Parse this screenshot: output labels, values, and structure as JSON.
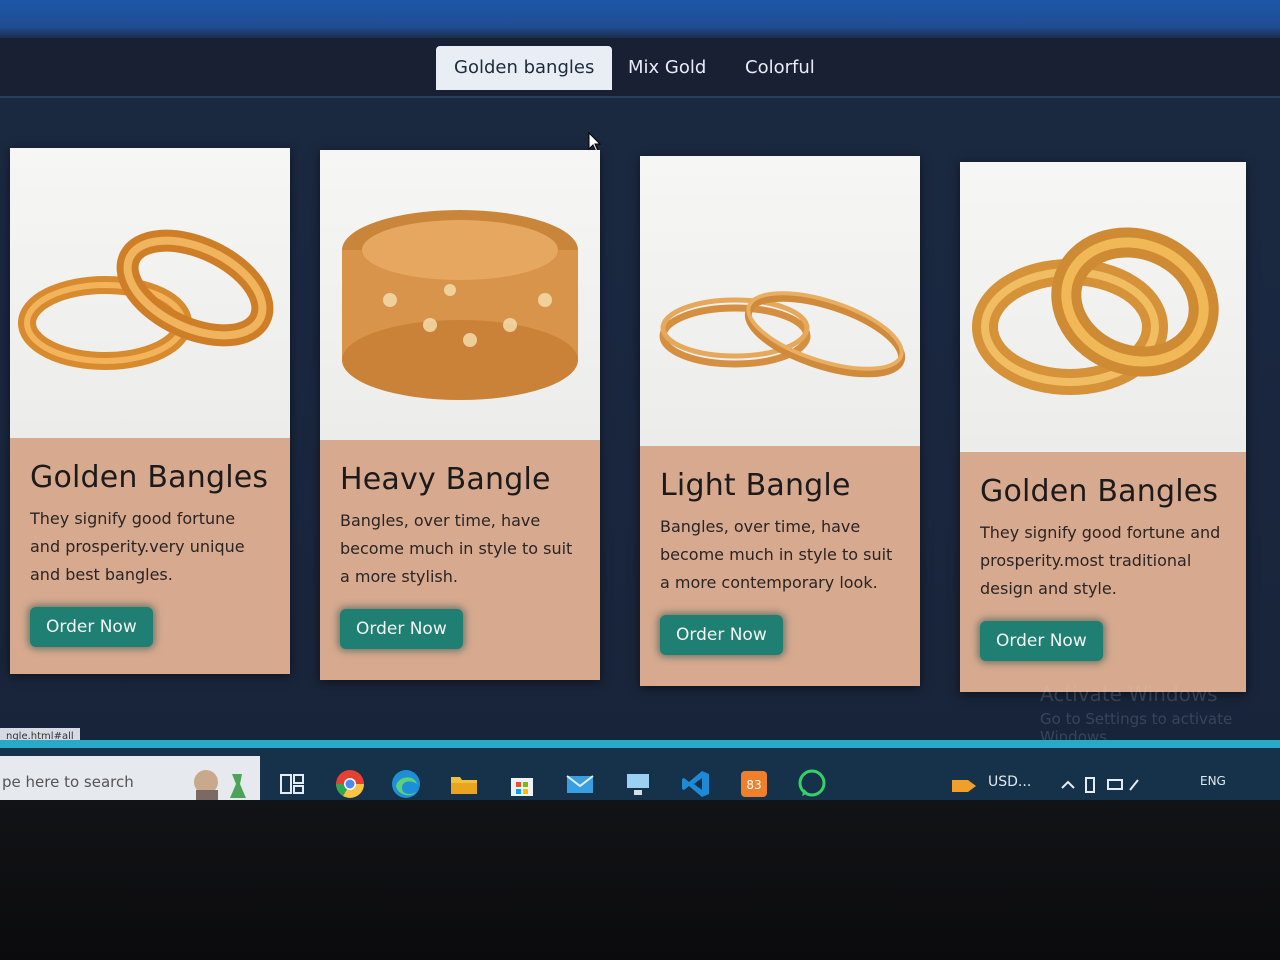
{
  "nav": {
    "tabs": [
      {
        "label": "Golden bangles",
        "active": true
      },
      {
        "label": "Mix Gold",
        "active": false
      },
      {
        "label": "Colorful",
        "active": false
      }
    ]
  },
  "cards": [
    {
      "title": "Golden Bangles",
      "description": "They signify good fortune and prosperity.very unique and best bangles.",
      "button": "Order Now",
      "image_icon": "two-gold-bangles"
    },
    {
      "title": "Heavy Bangle",
      "description": "Bangles, over time, have become much in style to suit a more stylish.",
      "button": "Order Now",
      "image_icon": "wide-gold-bangle"
    },
    {
      "title": "Light Bangle",
      "description": "Bangles, over time, have become much in style to suit a more contemporary look.",
      "button": "Order Now",
      "image_icon": "thin-gold-bangles"
    },
    {
      "title": "Golden Bangles",
      "description": "They signify good fortune and prosperity.most traditional design and style.",
      "button": "Order Now",
      "image_icon": "stacked-gold-bangles"
    }
  ],
  "watermark": {
    "line1": "Activate Windows",
    "line2": "Go to Settings to activate Windows."
  },
  "status_url": "ngle.html#all",
  "taskbar": {
    "search_placeholder": "pe here to search",
    "apps": [
      "task-view-icon",
      "chrome-icon",
      "edge-icon",
      "file-explorer-icon",
      "store-icon",
      "mail-icon",
      "network-app-icon",
      "vscode-icon",
      "xampp-icon",
      "whatsapp-icon"
    ],
    "weather": "USD...",
    "lang": "ENG"
  },
  "colors": {
    "card_bg": "#d7aa90",
    "button": "#1f7f72",
    "nav_bg": "#192033",
    "page_bg": "#1a2740"
  }
}
